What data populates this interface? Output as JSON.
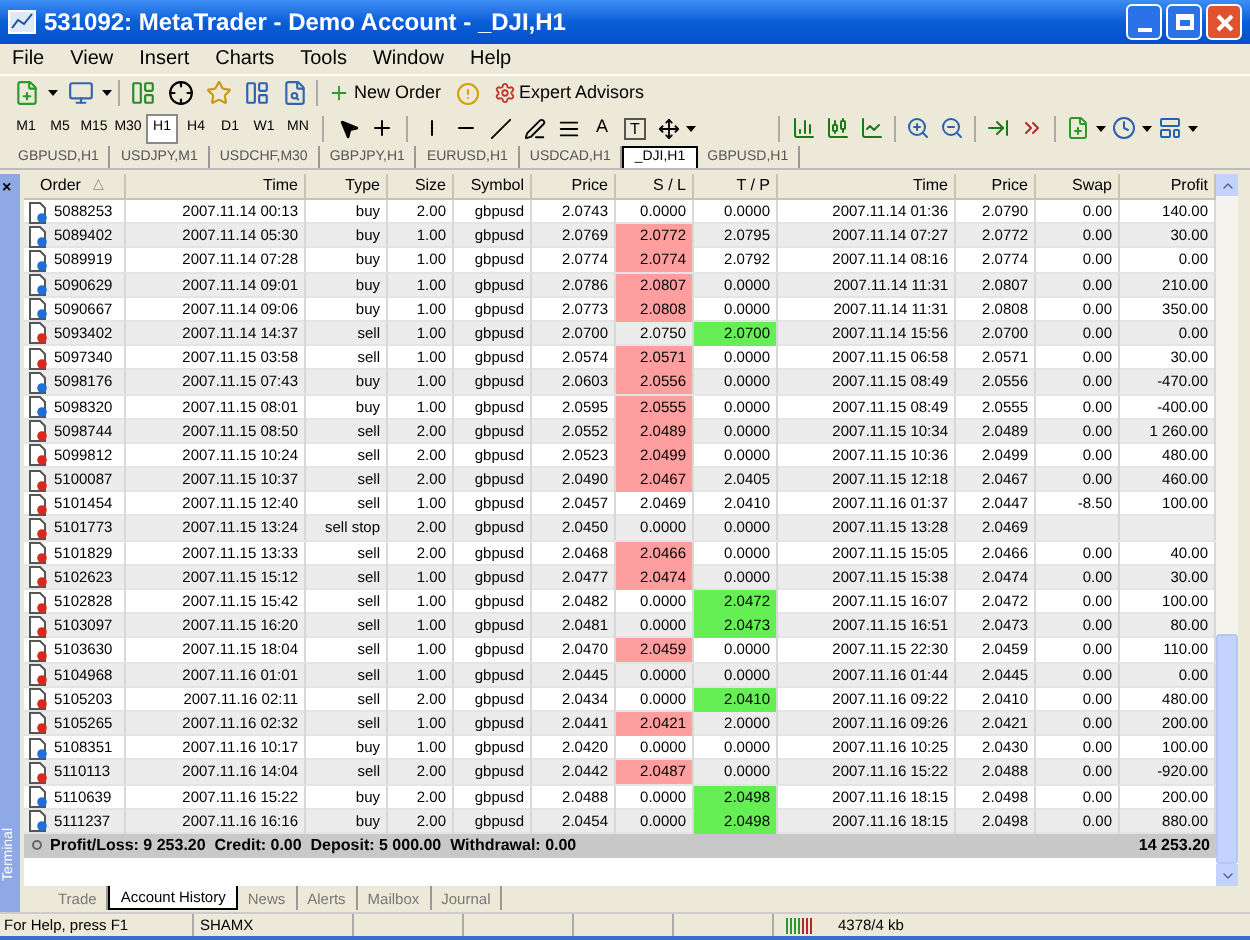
{
  "window": {
    "title": "531092: MetaTrader - Demo Account - _DJI,H1"
  },
  "menu": [
    "File",
    "View",
    "Insert",
    "Charts",
    "Tools",
    "Window",
    "Help"
  ],
  "toolbar": {
    "new_order": "New Order",
    "expert_advisors": "Expert Advisors",
    "text_tool": "A",
    "label_tool": "T"
  },
  "timeframes": [
    {
      "label": "M1",
      "selected": false
    },
    {
      "label": "M5",
      "selected": false
    },
    {
      "label": "M15",
      "selected": false
    },
    {
      "label": "M30",
      "selected": false
    },
    {
      "label": "H1",
      "selected": true
    },
    {
      "label": "H4",
      "selected": false
    },
    {
      "label": "D1",
      "selected": false
    },
    {
      "label": "W1",
      "selected": false
    },
    {
      "label": "MN",
      "selected": false
    }
  ],
  "chart_tabs": [
    {
      "label": "GBPUSD,H1",
      "selected": false
    },
    {
      "label": "USDJPY,M1",
      "selected": false
    },
    {
      "label": "USDCHF,M30",
      "selected": false
    },
    {
      "label": "GBPJPY,H1",
      "selected": false
    },
    {
      "label": "EURUSD,H1",
      "selected": false
    },
    {
      "label": "USDCAD,H1",
      "selected": false
    },
    {
      "label": "_DJI,H1",
      "selected": true
    },
    {
      "label": "GBPUSD,H1",
      "selected": false
    }
  ],
  "terminal": {
    "side_label": "Terminal",
    "close": "×",
    "sort_mark": "△",
    "columns": [
      "Order",
      "Time",
      "Type",
      "Size",
      "Symbol",
      "Price",
      "S / L",
      "T / P",
      "Time",
      "Price",
      "Swap",
      "Profit"
    ],
    "rows": [
      {
        "kind": "buy",
        "order": "5088253",
        "time": "2007.11.14 00:13",
        "type": "buy",
        "size": "2.00",
        "symbol": "gbpusd",
        "price": "2.0743",
        "sl": "0.0000",
        "sl_hit": false,
        "tp": "0.0000",
        "tp_hit": false,
        "close_time": "2007.11.14 01:36",
        "close_price": "2.0790",
        "swap": "0.00",
        "profit": "140.00"
      },
      {
        "kind": "buy",
        "order": "5089402",
        "time": "2007.11.14 05:30",
        "type": "buy",
        "size": "1.00",
        "symbol": "gbpusd",
        "price": "2.0769",
        "sl": "2.0772",
        "sl_hit": true,
        "tp": "2.0795",
        "tp_hit": false,
        "close_time": "2007.11.14 07:27",
        "close_price": "2.0772",
        "swap": "0.00",
        "profit": "30.00"
      },
      {
        "kind": "buy",
        "order": "5089919",
        "time": "2007.11.14 07:28",
        "type": "buy",
        "size": "1.00",
        "symbol": "gbpusd",
        "price": "2.0774",
        "sl": "2.0774",
        "sl_hit": true,
        "tp": "2.0792",
        "tp_hit": false,
        "close_time": "2007.11.14 08:16",
        "close_price": "2.0774",
        "swap": "0.00",
        "profit": "0.00"
      },
      {
        "kind": "buy",
        "order": "5090629",
        "time": "2007.11.14 09:01",
        "type": "buy",
        "size": "1.00",
        "symbol": "gbpusd",
        "price": "2.0786",
        "sl": "2.0807",
        "sl_hit": true,
        "tp": "0.0000",
        "tp_hit": false,
        "close_time": "2007.11.14 11:31",
        "close_price": "2.0807",
        "swap": "0.00",
        "profit": "210.00"
      },
      {
        "kind": "buy",
        "order": "5090667",
        "time": "2007.11.14 09:06",
        "type": "buy",
        "size": "1.00",
        "symbol": "gbpusd",
        "price": "2.0773",
        "sl": "2.0808",
        "sl_hit": true,
        "tp": "0.0000",
        "tp_hit": false,
        "close_time": "2007.11.14 11:31",
        "close_price": "2.0808",
        "swap": "0.00",
        "profit": "350.00"
      },
      {
        "kind": "sell",
        "order": "5093402",
        "time": "2007.11.14 14:37",
        "type": "sell",
        "size": "1.00",
        "symbol": "gbpusd",
        "price": "2.0700",
        "sl": "2.0750",
        "sl_hit": false,
        "tp": "2.0700",
        "tp_hit": true,
        "close_time": "2007.11.14 15:56",
        "close_price": "2.0700",
        "swap": "0.00",
        "profit": "0.00"
      },
      {
        "kind": "sell",
        "order": "5097340",
        "time": "2007.11.15 03:58",
        "type": "sell",
        "size": "1.00",
        "symbol": "gbpusd",
        "price": "2.0574",
        "sl": "2.0571",
        "sl_hit": true,
        "tp": "0.0000",
        "tp_hit": false,
        "close_time": "2007.11.15 06:58",
        "close_price": "2.0571",
        "swap": "0.00",
        "profit": "30.00"
      },
      {
        "kind": "buy",
        "order": "5098176",
        "time": "2007.11.15 07:43",
        "type": "buy",
        "size": "1.00",
        "symbol": "gbpusd",
        "price": "2.0603",
        "sl": "2.0556",
        "sl_hit": true,
        "tp": "0.0000",
        "tp_hit": false,
        "close_time": "2007.11.15 08:49",
        "close_price": "2.0556",
        "swap": "0.00",
        "profit": "-470.00"
      },
      {
        "kind": "buy",
        "order": "5098320",
        "time": "2007.11.15 08:01",
        "type": "buy",
        "size": "1.00",
        "symbol": "gbpusd",
        "price": "2.0595",
        "sl": "2.0555",
        "sl_hit": true,
        "tp": "0.0000",
        "tp_hit": false,
        "close_time": "2007.11.15 08:49",
        "close_price": "2.0555",
        "swap": "0.00",
        "profit": "-400.00"
      },
      {
        "kind": "sell",
        "order": "5098744",
        "time": "2007.11.15 08:50",
        "type": "sell",
        "size": "2.00",
        "symbol": "gbpusd",
        "price": "2.0552",
        "sl": "2.0489",
        "sl_hit": true,
        "tp": "0.0000",
        "tp_hit": false,
        "close_time": "2007.11.15 10:34",
        "close_price": "2.0489",
        "swap": "0.00",
        "profit": "1 260.00"
      },
      {
        "kind": "sell",
        "order": "5099812",
        "time": "2007.11.15 10:24",
        "type": "sell",
        "size": "2.00",
        "symbol": "gbpusd",
        "price": "2.0523",
        "sl": "2.0499",
        "sl_hit": true,
        "tp": "0.0000",
        "tp_hit": false,
        "close_time": "2007.11.15 10:36",
        "close_price": "2.0499",
        "swap": "0.00",
        "profit": "480.00"
      },
      {
        "kind": "sell",
        "order": "5100087",
        "time": "2007.11.15 10:37",
        "type": "sell",
        "size": "2.00",
        "symbol": "gbpusd",
        "price": "2.0490",
        "sl": "2.0467",
        "sl_hit": true,
        "tp": "2.0405",
        "tp_hit": false,
        "close_time": "2007.11.15 12:18",
        "close_price": "2.0467",
        "swap": "0.00",
        "profit": "460.00"
      },
      {
        "kind": "sell",
        "order": "5101454",
        "time": "2007.11.15 12:40",
        "type": "sell",
        "size": "1.00",
        "symbol": "gbpusd",
        "price": "2.0457",
        "sl": "2.0469",
        "sl_hit": false,
        "tp": "2.0410",
        "tp_hit": false,
        "close_time": "2007.11.16 01:37",
        "close_price": "2.0447",
        "swap": "-8.50",
        "profit": "100.00"
      },
      {
        "kind": "sell",
        "order": "5101773",
        "time": "2007.11.15 13:24",
        "type": "sell stop",
        "size": "2.00",
        "symbol": "gbpusd",
        "price": "2.0450",
        "sl": "0.0000",
        "sl_hit": false,
        "tp": "0.0000",
        "tp_hit": false,
        "close_time": "2007.11.15 13:28",
        "close_price": "2.0469"
      },
      {
        "kind": "sell",
        "order": "5101829",
        "time": "2007.11.15 13:33",
        "type": "sell",
        "size": "2.00",
        "symbol": "gbpusd",
        "price": "2.0468",
        "sl": "2.0466",
        "sl_hit": true,
        "tp": "0.0000",
        "tp_hit": false,
        "close_time": "2007.11.15 15:05",
        "close_price": "2.0466",
        "swap": "0.00",
        "profit": "40.00"
      },
      {
        "kind": "sell",
        "order": "5102623",
        "time": "2007.11.15 15:12",
        "type": "sell",
        "size": "1.00",
        "symbol": "gbpusd",
        "price": "2.0477",
        "sl": "2.0474",
        "sl_hit": true,
        "tp": "0.0000",
        "tp_hit": false,
        "close_time": "2007.11.15 15:38",
        "close_price": "2.0474",
        "swap": "0.00",
        "profit": "30.00"
      },
      {
        "kind": "sell",
        "order": "5102828",
        "time": "2007.11.15 15:42",
        "type": "sell",
        "size": "1.00",
        "symbol": "gbpusd",
        "price": "2.0482",
        "sl": "0.0000",
        "sl_hit": false,
        "tp": "2.0472",
        "tp_hit": true,
        "close_time": "2007.11.15 16:07",
        "close_price": "2.0472",
        "swap": "0.00",
        "profit": "100.00"
      },
      {
        "kind": "sell",
        "order": "5103097",
        "time": "2007.11.15 16:20",
        "type": "sell",
        "size": "1.00",
        "symbol": "gbpusd",
        "price": "2.0481",
        "sl": "0.0000",
        "sl_hit": false,
        "tp": "2.0473",
        "tp_hit": true,
        "close_time": "2007.11.15 16:51",
        "close_price": "2.0473",
        "swap": "0.00",
        "profit": "80.00"
      },
      {
        "kind": "sell",
        "order": "5103630",
        "time": "2007.11.15 18:04",
        "type": "sell",
        "size": "1.00",
        "symbol": "gbpusd",
        "price": "2.0470",
        "sl": "2.0459",
        "sl_hit": true,
        "tp": "0.0000",
        "tp_hit": false,
        "close_time": "2007.11.15 22:30",
        "close_price": "2.0459",
        "swap": "0.00",
        "profit": "110.00"
      },
      {
        "kind": "sell",
        "order": "5104968",
        "time": "2007.11.16 01:01",
        "type": "sell",
        "size": "1.00",
        "symbol": "gbpusd",
        "price": "2.0445",
        "sl": "0.0000",
        "sl_hit": false,
        "tp": "0.0000",
        "tp_hit": false,
        "close_time": "2007.11.16 01:44",
        "close_price": "2.0445",
        "swap": "0.00",
        "profit": "0.00"
      },
      {
        "kind": "sell",
        "order": "5105203",
        "time": "2007.11.16 02:11",
        "type": "sell",
        "size": "2.00",
        "symbol": "gbpusd",
        "price": "2.0434",
        "sl": "0.0000",
        "sl_hit": false,
        "tp": "2.0410",
        "tp_hit": true,
        "close_time": "2007.11.16 09:22",
        "close_price": "2.0410",
        "swap": "0.00",
        "profit": "480.00"
      },
      {
        "kind": "sell",
        "order": "5105265",
        "time": "2007.11.16 02:32",
        "type": "sell",
        "size": "1.00",
        "symbol": "gbpusd",
        "price": "2.0441",
        "sl": "2.0421",
        "sl_hit": true,
        "tp": "2.0000",
        "tp_hit": false,
        "close_time": "2007.11.16 09:26",
        "close_price": "2.0421",
        "swap": "0.00",
        "profit": "200.00"
      },
      {
        "kind": "buy",
        "order": "5108351",
        "time": "2007.11.16 10:17",
        "type": "buy",
        "size": "1.00",
        "symbol": "gbpusd",
        "price": "2.0420",
        "sl": "0.0000",
        "sl_hit": false,
        "tp": "0.0000",
        "tp_hit": false,
        "close_time": "2007.11.16 10:25",
        "close_price": "2.0430",
        "swap": "0.00",
        "profit": "100.00"
      },
      {
        "kind": "sell",
        "order": "5110113",
        "time": "2007.11.16 14:04",
        "type": "sell",
        "size": "2.00",
        "symbol": "gbpusd",
        "price": "2.0442",
        "sl": "2.0487",
        "sl_hit": true,
        "tp": "0.0000",
        "tp_hit": false,
        "close_time": "2007.11.16 15:22",
        "close_price": "2.0488",
        "swap": "0.00",
        "profit": "-920.00"
      },
      {
        "kind": "buy",
        "order": "5110639",
        "time": "2007.11.16 15:22",
        "type": "buy",
        "size": "2.00",
        "symbol": "gbpusd",
        "price": "2.0488",
        "sl": "0.0000",
        "sl_hit": false,
        "tp": "2.0498",
        "tp_hit": true,
        "close_time": "2007.11.16 18:15",
        "close_price": "2.0498",
        "swap": "0.00",
        "profit": "200.00"
      },
      {
        "kind": "buy",
        "order": "5111237",
        "time": "2007.11.16 16:16",
        "type": "buy",
        "size": "2.00",
        "symbol": "gbpusd",
        "price": "2.0454",
        "sl": "0.0000",
        "sl_hit": false,
        "tp": "2.0498",
        "tp_hit": true,
        "close_time": "2007.11.16 18:15",
        "close_price": "2.0498",
        "swap": "0.00",
        "profit": "880.00"
      }
    ],
    "summary": "Profit/Loss: 9 253.20  Credit: 0.00  Deposit: 5 000.00  Withdrawal: 0.00",
    "total": "14 253.20"
  },
  "bottom_tabs": [
    {
      "label": "Trade",
      "selected": false
    },
    {
      "label": "Account History",
      "selected": true
    },
    {
      "label": "News",
      "selected": false
    },
    {
      "label": "Alerts",
      "selected": false
    },
    {
      "label": "Mailbox",
      "selected": false
    },
    {
      "label": "Journal",
      "selected": false
    }
  ],
  "status_bar": {
    "help": "For Help, press F1",
    "profile": "SHAMX",
    "traffic": "4378/4 kb"
  }
}
